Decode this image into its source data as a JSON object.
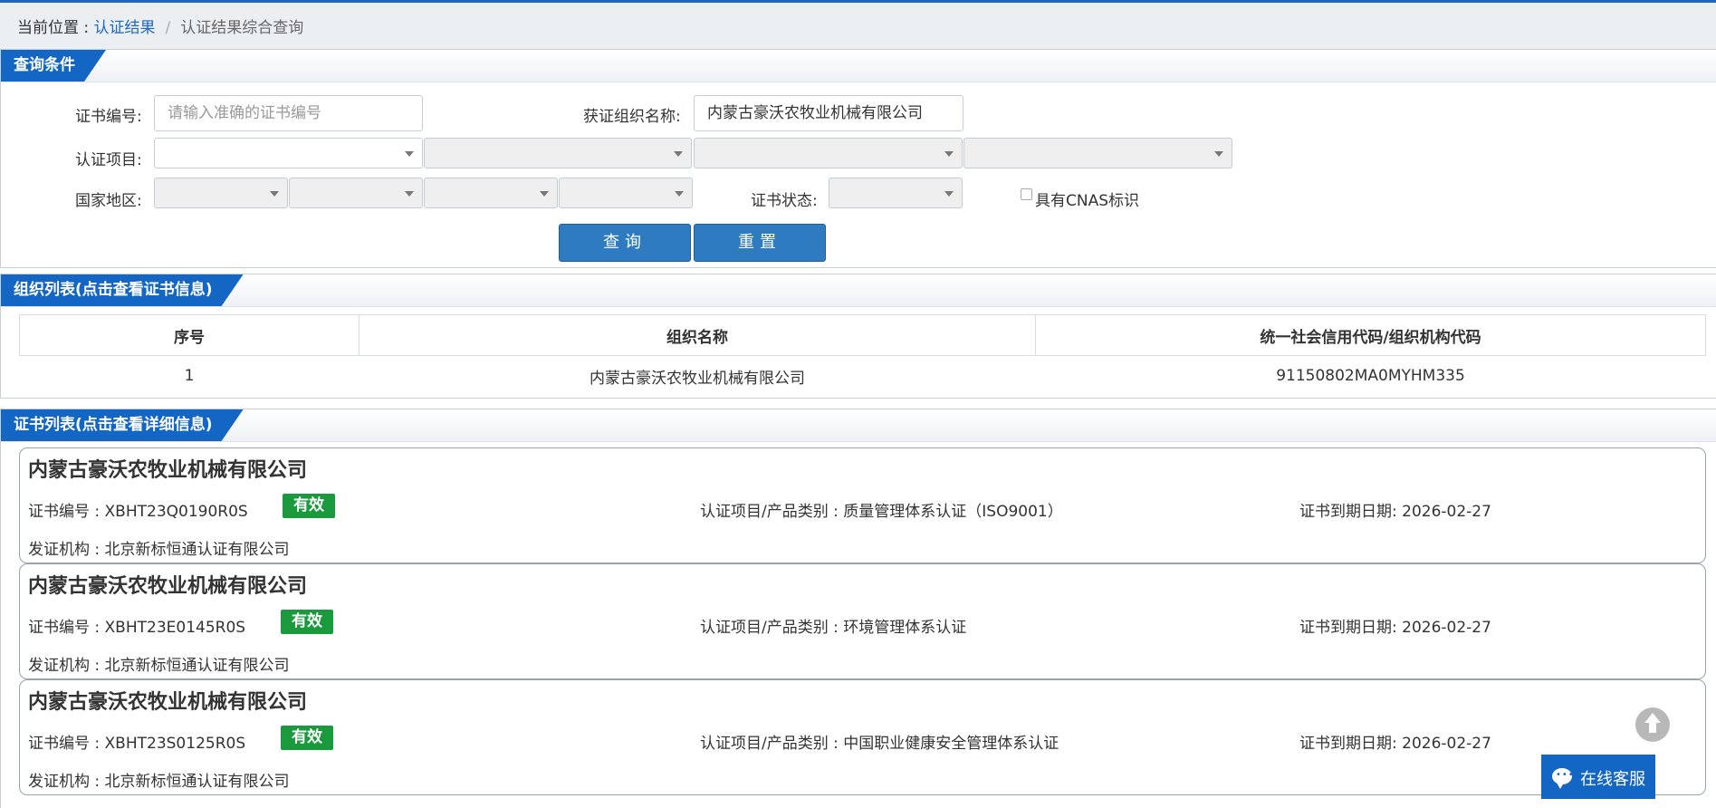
{
  "breadcrumb": {
    "prefix": "当前位置 : ",
    "link": "认证结果",
    "separator": "/",
    "current": "认证结果综合查询"
  },
  "query_panel": {
    "title": "查询条件",
    "cert_no_label": "证书编号:",
    "cert_no_placeholder": "请输入准确的证书编号",
    "org_name_label": "获证组织名称:",
    "org_name_value": "内蒙古豪沃农牧业机械有限公司",
    "cert_item_label": "认证项目:",
    "region_label": "国家地区:",
    "cert_status_label": "证书状态:",
    "cnas_label": "具有CNAS标识",
    "search_button": "查询",
    "reset_button": "重置"
  },
  "org_panel": {
    "title": "组织列表(点击查看证书信息)",
    "columns": [
      "序号",
      "组织名称",
      "统一社会信用代码/组织机构代码"
    ],
    "rows": [
      {
        "index": "1",
        "name": "内蒙古豪沃农牧业机械有限公司",
        "code": "91150802MA0MYHM335"
      }
    ]
  },
  "cert_panel": {
    "title": "证书列表(点击查看详细信息)",
    "certs": [
      {
        "org": "内蒙古豪沃农牧业机械有限公司",
        "cert_no": "证书编号 : XBHT23Q0190R0S",
        "status": "有效",
        "item": "认证项目/产品类别 : 质量管理体系认证（ISO9001）",
        "expiry": "证书到期日期: 2026-02-27",
        "issuer": "发证机构 : 北京新标恒通认证有限公司"
      },
      {
        "org": "内蒙古豪沃农牧业机械有限公司",
        "cert_no": "证书编号 : XBHT23E0145R0S",
        "status": "有效",
        "item": "认证项目/产品类别 : 环境管理体系认证",
        "expiry": "证书到期日期: 2026-02-27",
        "issuer": "发证机构 : 北京新标恒通认证有限公司"
      },
      {
        "org": "内蒙古豪沃农牧业机械有限公司",
        "cert_no": "证书编号 : XBHT23S0125R0S",
        "status": "有效",
        "item": "认证项目/产品类别 : 中国职业健康安全管理体系认证",
        "expiry": "证书到期日期: 2026-02-27",
        "issuer": "发证机构 : 北京新标恒通认证有限公司"
      }
    ]
  },
  "online_service": "在线客服",
  "colors": {
    "accent": "#1466c4",
    "status_valid": "#1a9a3d",
    "button": "#2f7bc1"
  }
}
